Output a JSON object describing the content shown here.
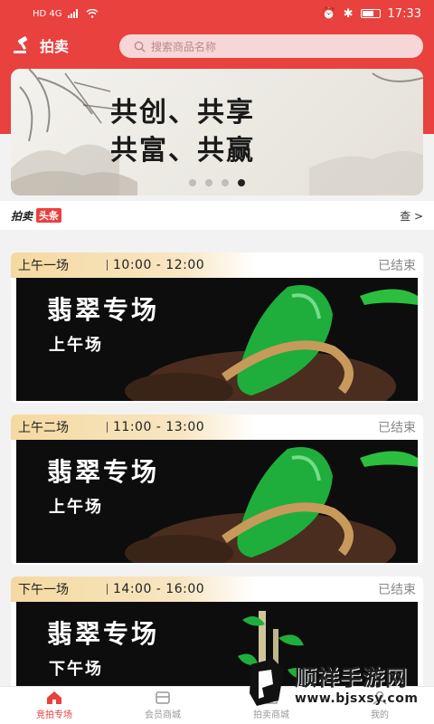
{
  "status_bar": {
    "carrier": "HD 4G",
    "time": "17:33"
  },
  "header": {
    "brand": "拍卖",
    "search_placeholder": "搜索商品名称"
  },
  "banner": {
    "line1": "共创、共享",
    "line2": "共富、共赢",
    "slides": 4,
    "active_slide": 4
  },
  "news": {
    "brand": "拍卖",
    "tag": "头条",
    "more": "查"
  },
  "sessions": [
    {
      "name": "上午一场",
      "time": "10:00 - 12:00",
      "status": "已结束",
      "title": "翡翠专场",
      "subtitle": "上午场"
    },
    {
      "name": "上午二场",
      "time": "11:00 - 13:00",
      "status": "已结束",
      "title": "翡翠专场",
      "subtitle": "上午场"
    },
    {
      "name": "下午一场",
      "time": "14:00 - 16:00",
      "status": "已结束",
      "title": "翡翠专场",
      "subtitle": "下午场"
    }
  ],
  "tabbar": [
    {
      "label": "竞拍专场",
      "icon": "home-icon"
    },
    {
      "label": "会员商城",
      "icon": "store-icon"
    },
    {
      "label": "拍卖商城",
      "icon": "shop-icon"
    },
    {
      "label": "我的",
      "icon": "user-icon"
    }
  ],
  "watermark": {
    "title": "顺祥手游网",
    "url": "www.bjsxsy.com"
  },
  "colors": {
    "brand_red": "#e8413e",
    "gold": "#f5d9a1",
    "jade": "#1fae3c"
  }
}
